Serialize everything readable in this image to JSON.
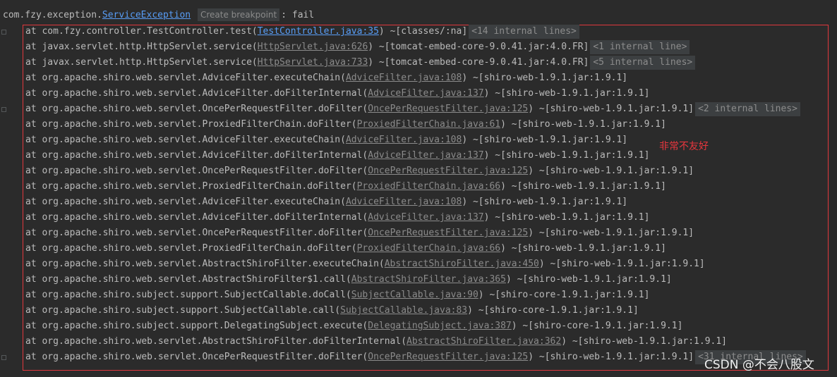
{
  "header": {
    "prefix": "com.fzy.exception.",
    "exception_link": "ServiceException",
    "breakpoint_label": "Create breakpoint",
    "suffix": ": fail"
  },
  "stack": [
    {
      "pre": "at com.fzy.controller.TestController.test(",
      "src": "TestController.java:35",
      "post": ") ~[classes/:na]",
      "folded": "<14 internal lines>",
      "primary": true
    },
    {
      "pre": "at javax.servlet.http.HttpServlet.service(",
      "src": "HttpServlet.java:626",
      "post": ") ~[tomcat-embed-core-9.0.41.jar:4.0.FR]",
      "folded": "<1 internal line>"
    },
    {
      "pre": "at javax.servlet.http.HttpServlet.service(",
      "src": "HttpServlet.java:733",
      "post": ") ~[tomcat-embed-core-9.0.41.jar:4.0.FR]",
      "folded": "<5 internal lines>"
    },
    {
      "pre": "at org.apache.shiro.web.servlet.AdviceFilter.executeChain(",
      "src": "AdviceFilter.java:108",
      "post": ") ~[shiro-web-1.9.1.jar:1.9.1]",
      "folded": ""
    },
    {
      "pre": "at org.apache.shiro.web.servlet.AdviceFilter.doFilterInternal(",
      "src": "AdviceFilter.java:137",
      "post": ") ~[shiro-web-1.9.1.jar:1.9.1]",
      "folded": ""
    },
    {
      "pre": "at org.apache.shiro.web.servlet.OncePerRequestFilter.doFilter(",
      "src": "OncePerRequestFilter.java:125",
      "post": ") ~[shiro-web-1.9.1.jar:1.9.1]",
      "folded": "<2 internal lines>"
    },
    {
      "pre": "at org.apache.shiro.web.servlet.ProxiedFilterChain.doFilter(",
      "src": "ProxiedFilterChain.java:61",
      "post": ") ~[shiro-web-1.9.1.jar:1.9.1]",
      "folded": ""
    },
    {
      "pre": "at org.apache.shiro.web.servlet.AdviceFilter.executeChain(",
      "src": "AdviceFilter.java:108",
      "post": ") ~[shiro-web-1.9.1.jar:1.9.1]",
      "folded": ""
    },
    {
      "pre": "at org.apache.shiro.web.servlet.AdviceFilter.doFilterInternal(",
      "src": "AdviceFilter.java:137",
      "post": ") ~[shiro-web-1.9.1.jar:1.9.1]",
      "folded": ""
    },
    {
      "pre": "at org.apache.shiro.web.servlet.OncePerRequestFilter.doFilter(",
      "src": "OncePerRequestFilter.java:125",
      "post": ") ~[shiro-web-1.9.1.jar:1.9.1]",
      "folded": ""
    },
    {
      "pre": "at org.apache.shiro.web.servlet.ProxiedFilterChain.doFilter(",
      "src": "ProxiedFilterChain.java:66",
      "post": ") ~[shiro-web-1.9.1.jar:1.9.1]",
      "folded": ""
    },
    {
      "pre": "at org.apache.shiro.web.servlet.AdviceFilter.executeChain(",
      "src": "AdviceFilter.java:108",
      "post": ") ~[shiro-web-1.9.1.jar:1.9.1]",
      "folded": ""
    },
    {
      "pre": "at org.apache.shiro.web.servlet.AdviceFilter.doFilterInternal(",
      "src": "AdviceFilter.java:137",
      "post": ") ~[shiro-web-1.9.1.jar:1.9.1]",
      "folded": ""
    },
    {
      "pre": "at org.apache.shiro.web.servlet.OncePerRequestFilter.doFilter(",
      "src": "OncePerRequestFilter.java:125",
      "post": ") ~[shiro-web-1.9.1.jar:1.9.1]",
      "folded": ""
    },
    {
      "pre": "at org.apache.shiro.web.servlet.ProxiedFilterChain.doFilter(",
      "src": "ProxiedFilterChain.java:66",
      "post": ") ~[shiro-web-1.9.1.jar:1.9.1]",
      "folded": ""
    },
    {
      "pre": "at org.apache.shiro.web.servlet.AbstractShiroFilter.executeChain(",
      "src": "AbstractShiroFilter.java:450",
      "post": ") ~[shiro-web-1.9.1.jar:1.9.1]",
      "folded": ""
    },
    {
      "pre": "at org.apache.shiro.web.servlet.AbstractShiroFilter$1.call(",
      "src": "AbstractShiroFilter.java:365",
      "post": ") ~[shiro-web-1.9.1.jar:1.9.1]",
      "folded": ""
    },
    {
      "pre": "at org.apache.shiro.subject.support.SubjectCallable.doCall(",
      "src": "SubjectCallable.java:90",
      "post": ") ~[shiro-core-1.9.1.jar:1.9.1]",
      "folded": ""
    },
    {
      "pre": "at org.apache.shiro.subject.support.SubjectCallable.call(",
      "src": "SubjectCallable.java:83",
      "post": ") ~[shiro-core-1.9.1.jar:1.9.1]",
      "folded": ""
    },
    {
      "pre": "at org.apache.shiro.subject.support.DelegatingSubject.execute(",
      "src": "DelegatingSubject.java:387",
      "post": ") ~[shiro-core-1.9.1.jar:1.9.1]",
      "folded": ""
    },
    {
      "pre": "at org.apache.shiro.web.servlet.AbstractShiroFilter.doFilterInternal(",
      "src": "AbstractShiroFilter.java:362",
      "post": ") ~[shiro-web-1.9.1.jar:1.9.1]",
      "folded": ""
    },
    {
      "pre": "at org.apache.shiro.web.servlet.OncePerRequestFilter.doFilter(",
      "src": "OncePerRequestFilter.java:125",
      "post": ") ~[shiro-web-1.9.1.jar:1.9.1]",
      "folded": "<31 internal lines>"
    }
  ],
  "annotation": "非常不友好",
  "watermark": "CSDN @不会八股文",
  "colors": {
    "background": "#2b2b2b",
    "text": "#bbbbbb",
    "link": "#589df6",
    "highlight_box": "#e0373d",
    "annotation": "#e8363d"
  }
}
